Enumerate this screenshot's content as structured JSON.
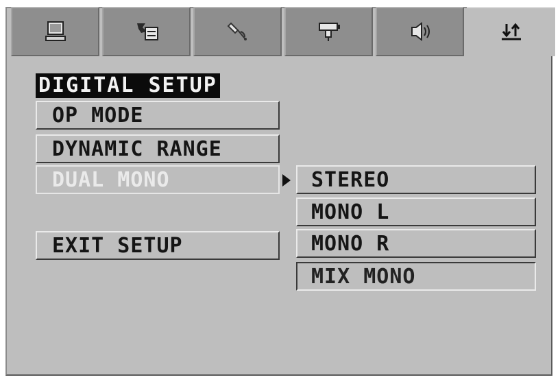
{
  "tabs": [
    {
      "icon": "monitor-icon",
      "active": false
    },
    {
      "icon": "language-icon",
      "active": false
    },
    {
      "icon": "satellite-icon",
      "active": false
    },
    {
      "icon": "projector-icon",
      "active": false
    },
    {
      "icon": "speaker-icon",
      "active": false
    },
    {
      "icon": "digital-setup-icon",
      "active": true
    }
  ],
  "menu": {
    "title": "DIGITAL SETUP",
    "items": [
      "OP MODE",
      "DYNAMIC RANGE",
      "DUAL MONO",
      "EXIT SETUP"
    ],
    "selected": "DUAL MONO"
  },
  "submenu": {
    "options": [
      "STEREO",
      "MONO L",
      "MONO R",
      "MIX MONO"
    ],
    "selected": "MIX MONO"
  },
  "colors": {
    "panel": "#bebebe",
    "tab_inactive": "#8e8e8e",
    "title_bg": "#0b0b0b",
    "selected_text": "#eaeaea"
  }
}
